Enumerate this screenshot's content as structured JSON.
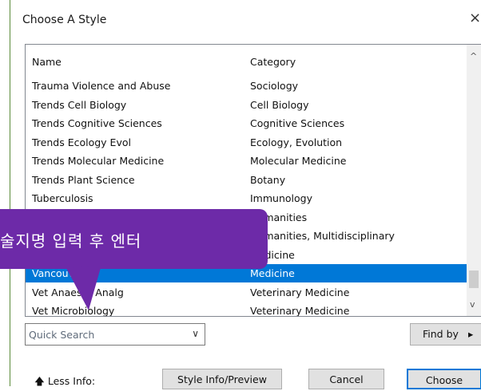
{
  "dialog": {
    "title": "Choose A Style",
    "close_glyph": "×"
  },
  "list": {
    "headers": {
      "name": "Name",
      "category": "Category"
    },
    "rows": [
      {
        "name": "Trauma Violence and Abuse",
        "category": "Sociology"
      },
      {
        "name": "Trends Cell Biology",
        "category": "Cell Biology"
      },
      {
        "name": "Trends Cognitive Sciences",
        "category": "Cognitive Sciences"
      },
      {
        "name": "Trends Ecology Evol",
        "category": "Ecology, Evolution"
      },
      {
        "name": "Trends Molecular Medicine",
        "category": "Molecular Medicine"
      },
      {
        "name": "Trends Plant Science",
        "category": "Botany"
      },
      {
        "name": "Tuberculosis",
        "category": "Immunology"
      },
      {
        "name": "",
        "category": "Humanities"
      },
      {
        "name": "",
        "category": "Humanities, Multidisciplinary"
      },
      {
        "name": "",
        "category": "Medicine"
      },
      {
        "name": "Vancouver",
        "category": "Medicine",
        "selected": true
      },
      {
        "name": "Vet Anaesth Analg",
        "category": "Veterinary Medicine"
      },
      {
        "name": "Vet Microbiology",
        "category": "Veterinary Medicine"
      }
    ],
    "scroll_up": "^",
    "scroll_down": "v"
  },
  "search": {
    "placeholder": "Quick Search",
    "chevron": "∨"
  },
  "find_by": {
    "label": "Find by",
    "arrow": "▸"
  },
  "less_info": {
    "label": "Less Info:",
    "arrow": "🡅"
  },
  "buttons": {
    "style_info": "Style Info/Preview",
    "cancel": "Cancel",
    "choose": "Choose"
  },
  "overlay": {
    "text": "술지명 입력 후 엔터"
  },
  "colors": {
    "accent": "#0078d7",
    "bubble": "#6d2aa8"
  }
}
